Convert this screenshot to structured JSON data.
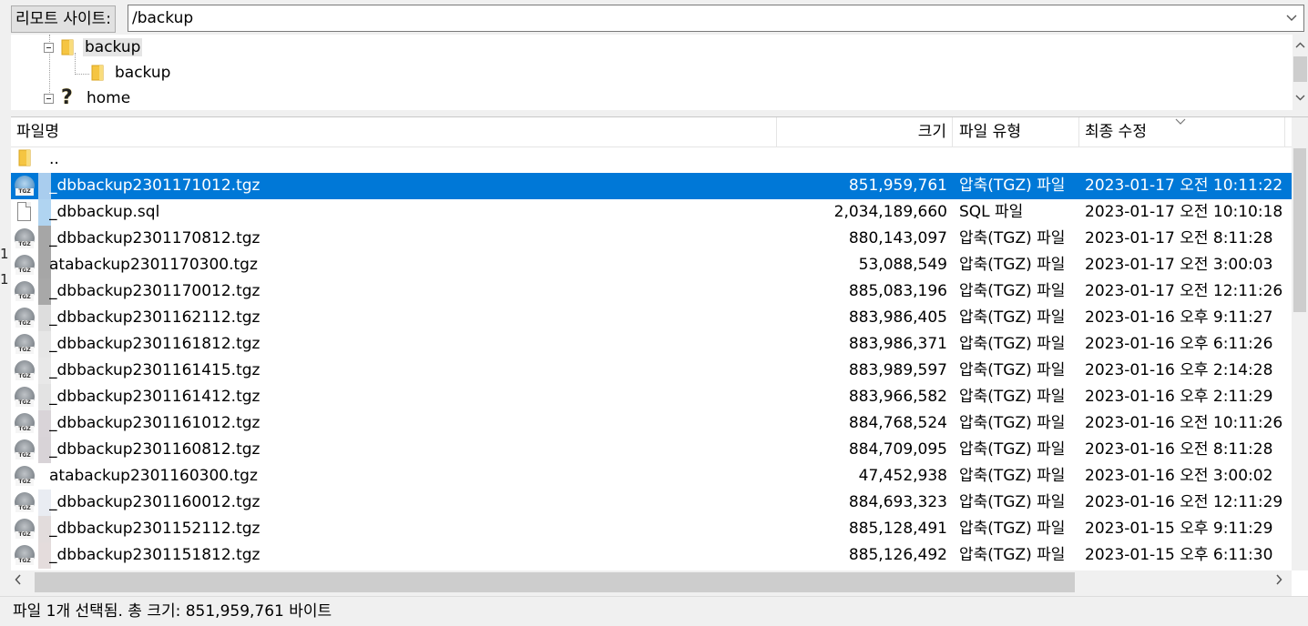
{
  "pathbar": {
    "label": "리모트 사이트:",
    "path": "/backup"
  },
  "tree": {
    "items": [
      {
        "label": "backup",
        "icon": "folder-icon"
      },
      {
        "label": "backup",
        "icon": "folder-icon"
      },
      {
        "label": "home",
        "icon": "unknown-folder-icon"
      }
    ]
  },
  "columns": {
    "name": "파일명",
    "size": "크기",
    "type": "파일 유형",
    "modified": "최종 수정"
  },
  "files": [
    {
      "name": "..",
      "size": "",
      "type": "",
      "modified": "",
      "icon": "folder-icon"
    },
    {
      "name": "_dbbackup2301171012.tgz",
      "size": "851,959,761",
      "type": "압축(TGZ) 파일",
      "modified": "2023-01-17 오전 10:11:22",
      "icon": "tgz-icon"
    },
    {
      "name": "_dbbackup.sql",
      "size": "2,034,189,660",
      "type": "SQL 파일",
      "modified": "2023-01-17 오전 10:10:18",
      "icon": "document-icon"
    },
    {
      "name": "_dbbackup2301170812.tgz",
      "size": "880,143,097",
      "type": "압축(TGZ) 파일",
      "modified": "2023-01-17 오전 8:11:28",
      "icon": "tgz-icon"
    },
    {
      "name": "atabackup2301170300.tgz",
      "size": "53,088,549",
      "type": "압축(TGZ) 파일",
      "modified": "2023-01-17 오전 3:00:03",
      "icon": "tgz-icon"
    },
    {
      "name": "_dbbackup2301170012.tgz",
      "size": "885,083,196",
      "type": "압축(TGZ) 파일",
      "modified": "2023-01-17 오전 12:11:26",
      "icon": "tgz-icon"
    },
    {
      "name": "_dbbackup2301162112.tgz",
      "size": "883,986,405",
      "type": "압축(TGZ) 파일",
      "modified": "2023-01-16 오후 9:11:27",
      "icon": "tgz-icon"
    },
    {
      "name": "_dbbackup2301161812.tgz",
      "size": "883,986,371",
      "type": "압축(TGZ) 파일",
      "modified": "2023-01-16 오후 6:11:26",
      "icon": "tgz-icon"
    },
    {
      "name": "_dbbackup2301161415.tgz",
      "size": "883,989,597",
      "type": "압축(TGZ) 파일",
      "modified": "2023-01-16 오후 2:14:28",
      "icon": "tgz-icon"
    },
    {
      "name": "_dbbackup2301161412.tgz",
      "size": "883,966,582",
      "type": "압축(TGZ) 파일",
      "modified": "2023-01-16 오후 2:11:29",
      "icon": "tgz-icon"
    },
    {
      "name": "_dbbackup2301161012.tgz",
      "size": "884,768,524",
      "type": "압축(TGZ) 파일",
      "modified": "2023-01-16 오전 10:11:26",
      "icon": "tgz-icon"
    },
    {
      "name": "_dbbackup2301160812.tgz",
      "size": "884,709,095",
      "type": "압축(TGZ) 파일",
      "modified": "2023-01-16 오전 8:11:28",
      "icon": "tgz-icon"
    },
    {
      "name": "atabackup2301160300.tgz",
      "size": "47,452,938",
      "type": "압축(TGZ) 파일",
      "modified": "2023-01-16 오전 3:00:02",
      "icon": "tgz-icon"
    },
    {
      "name": "_dbbackup2301160012.tgz",
      "size": "884,693,323",
      "type": "압축(TGZ) 파일",
      "modified": "2023-01-16 오전 12:11:29",
      "icon": "tgz-icon"
    },
    {
      "name": "_dbbackup2301152112.tgz",
      "size": "885,128,491",
      "type": "압축(TGZ) 파일",
      "modified": "2023-01-15 오후 9:11:29",
      "icon": "tgz-icon"
    },
    {
      "name": "_dbbackup2301151812.tgz",
      "size": "885,126,492",
      "type": "압축(TGZ) 파일",
      "modified": "2023-01-15 오후 6:11:30",
      "icon": "tgz-icon"
    }
  ],
  "selected_index": 1,
  "status": "파일 1개 선택됨. 총 크기: 851,959,761 바이트",
  "colors": {
    "selection": "#0078d7",
    "background": "#f0f0f0",
    "list_background": "#ffffff"
  }
}
